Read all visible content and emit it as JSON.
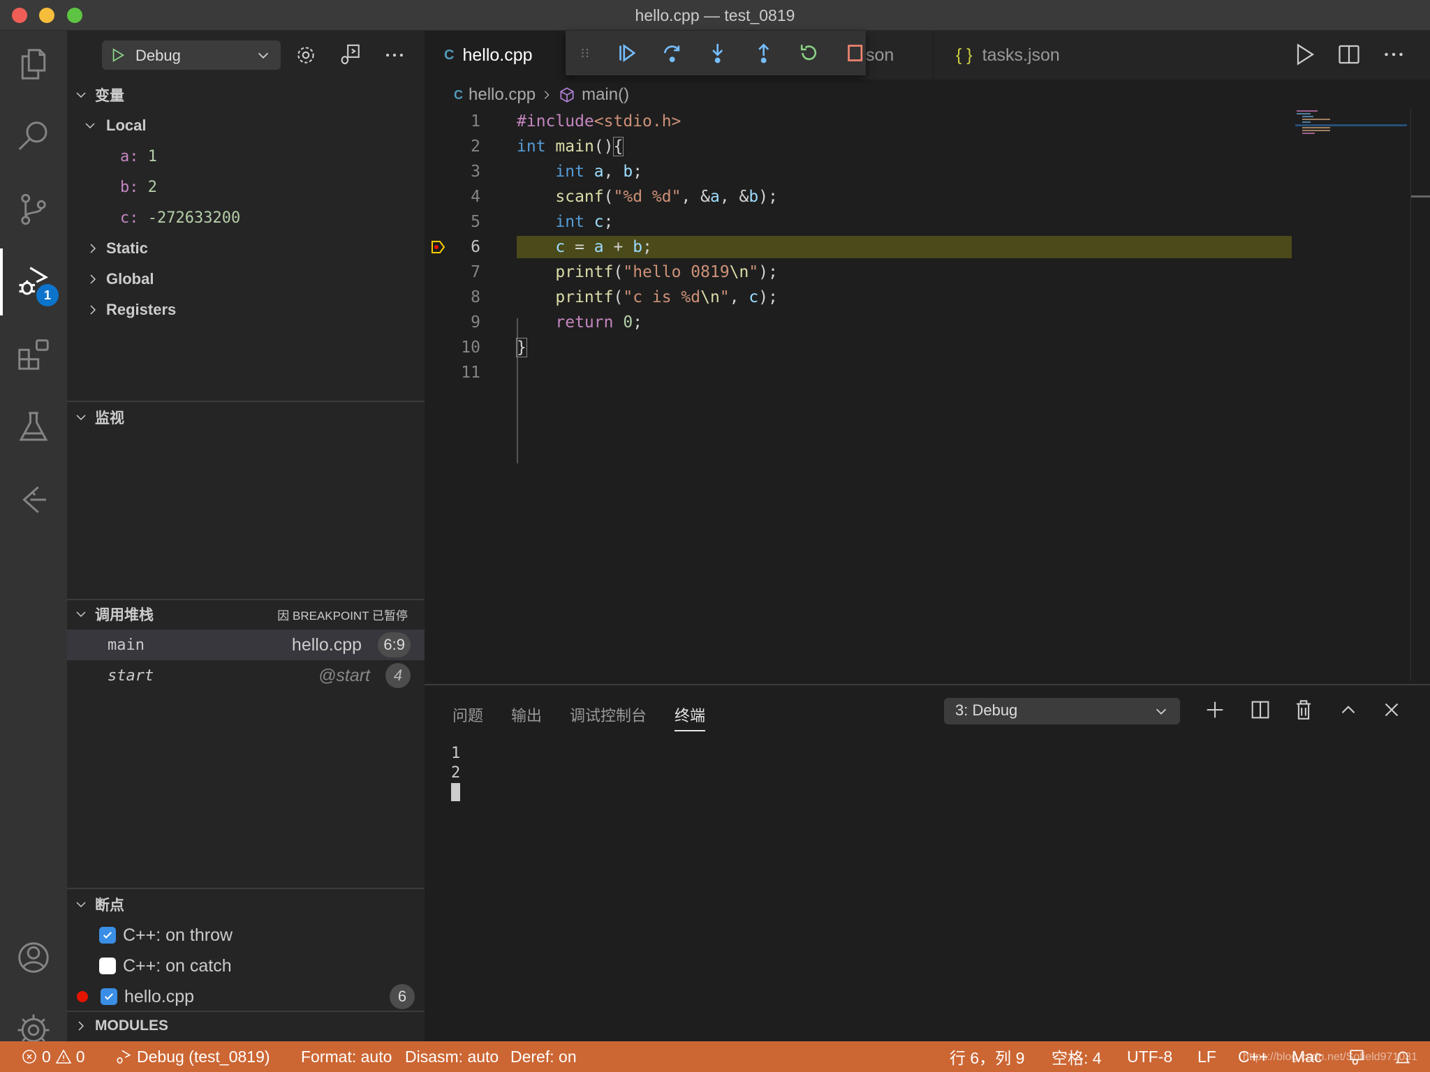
{
  "window": {
    "title": "hello.cpp — test_0819"
  },
  "activity_bar": {
    "items": [
      "explorer",
      "search",
      "source-control",
      "run-debug",
      "extensions",
      "testing",
      "remote"
    ],
    "debug_badge": "1"
  },
  "sidebar": {
    "debug_config": "Debug",
    "variables": {
      "title": "变量",
      "local_label": "Local",
      "locals": [
        {
          "name": "a:",
          "value": "1"
        },
        {
          "name": "b:",
          "value": "2"
        },
        {
          "name": "c:",
          "value": "-272633200"
        }
      ],
      "scopes": [
        "Static",
        "Global",
        "Registers"
      ]
    },
    "watch": {
      "title": "监视"
    },
    "call_stack": {
      "title": "调用堆栈",
      "status": "因 BREAKPOINT 已暂停",
      "frames": [
        {
          "name": "main",
          "source": "hello.cpp",
          "pos": "6:9"
        },
        {
          "name": "start",
          "source": "@start",
          "pos": "4"
        }
      ]
    },
    "breakpoints": {
      "title": "断点",
      "items": [
        {
          "label": "C++: on throw",
          "checked": true
        },
        {
          "label": "C++: on catch",
          "checked": false
        },
        {
          "label": "hello.cpp",
          "checked": true,
          "line": "6"
        }
      ]
    },
    "modules": {
      "title": "MODULES"
    }
  },
  "tabs": [
    {
      "label": "hello.cpp",
      "active": true
    },
    {
      "label": "launch.json",
      "visible_fragment": "son"
    },
    {
      "label": "tasks.json"
    }
  ],
  "breadcrumb": {
    "file": "hello.cpp",
    "symbol": "main()"
  },
  "editor": {
    "current_line": 6,
    "lines": [
      "1",
      "2",
      "3",
      "4",
      "5",
      "6",
      "7",
      "8",
      "9",
      "10",
      "11"
    ]
  },
  "panel": {
    "tabs": [
      "问题",
      "输出",
      "调试控制台",
      "终端"
    ],
    "active_tab": "终端",
    "terminal_select": "3: Debug",
    "terminal_lines": [
      "1",
      "2"
    ]
  },
  "statusbar": {
    "errors": "0",
    "warnings": "0",
    "debug": "Debug (test_0819)",
    "format": "Format: auto",
    "disasm": "Disasm: auto",
    "deref": "Deref: on",
    "position": "行 6，列 9",
    "spaces": "空格: 4",
    "encoding": "UTF-8",
    "eol": "LF",
    "language": "C++",
    "platform": "Mac",
    "watermark": "https://blog.csdn.net/Sofield971031",
    "bg_color": "#cc6633"
  }
}
